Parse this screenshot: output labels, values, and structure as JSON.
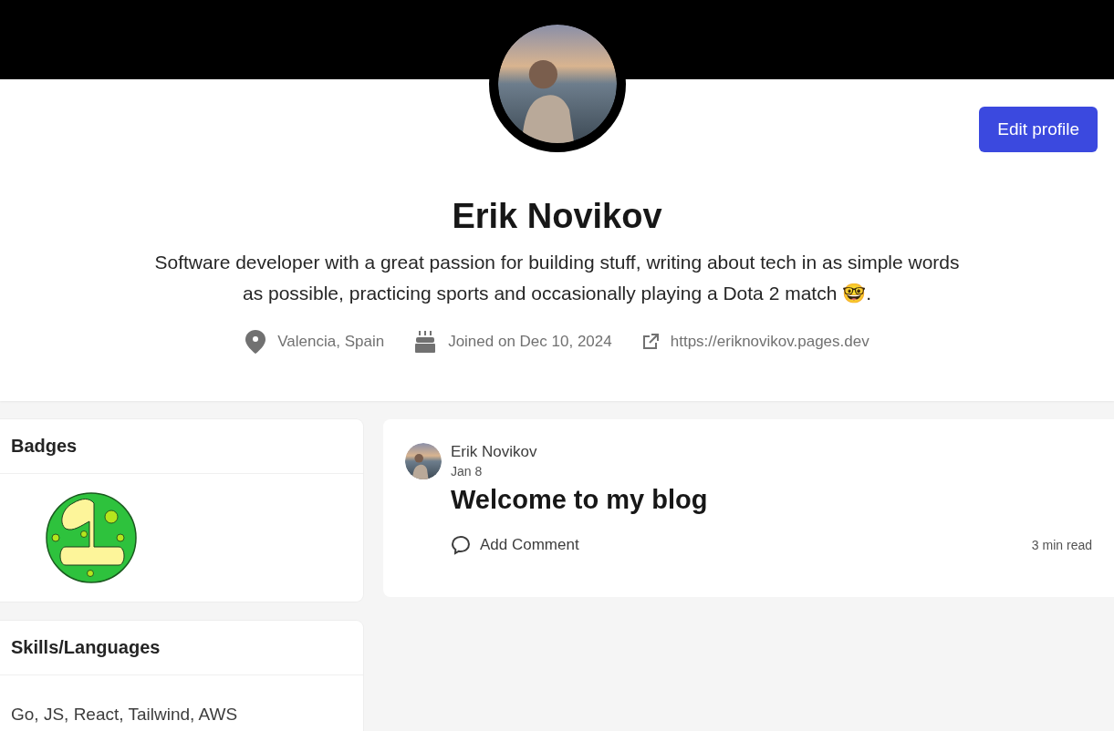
{
  "profile": {
    "name": "Erik Novikov",
    "bio": "Software developer with a great passion for building stuff, writing about tech in as simple words as possible, practicing sports and occasionally playing a Dota 2 match 🤓.",
    "location": "Valencia, Spain",
    "joined": "Joined on Dec 10, 2024",
    "website": "https://eriknovikov.pages.dev"
  },
  "edit_button": "Edit profile",
  "badges_card": {
    "title": "Badges"
  },
  "skills_card": {
    "title": "Skills/Languages",
    "text": "Go, JS, React, Tailwind, AWS"
  },
  "post": {
    "author": "Erik Novikov",
    "date": "Jan 8",
    "title": "Welcome to my blog",
    "comment_label": "Add Comment",
    "read_time": "3 min read"
  }
}
